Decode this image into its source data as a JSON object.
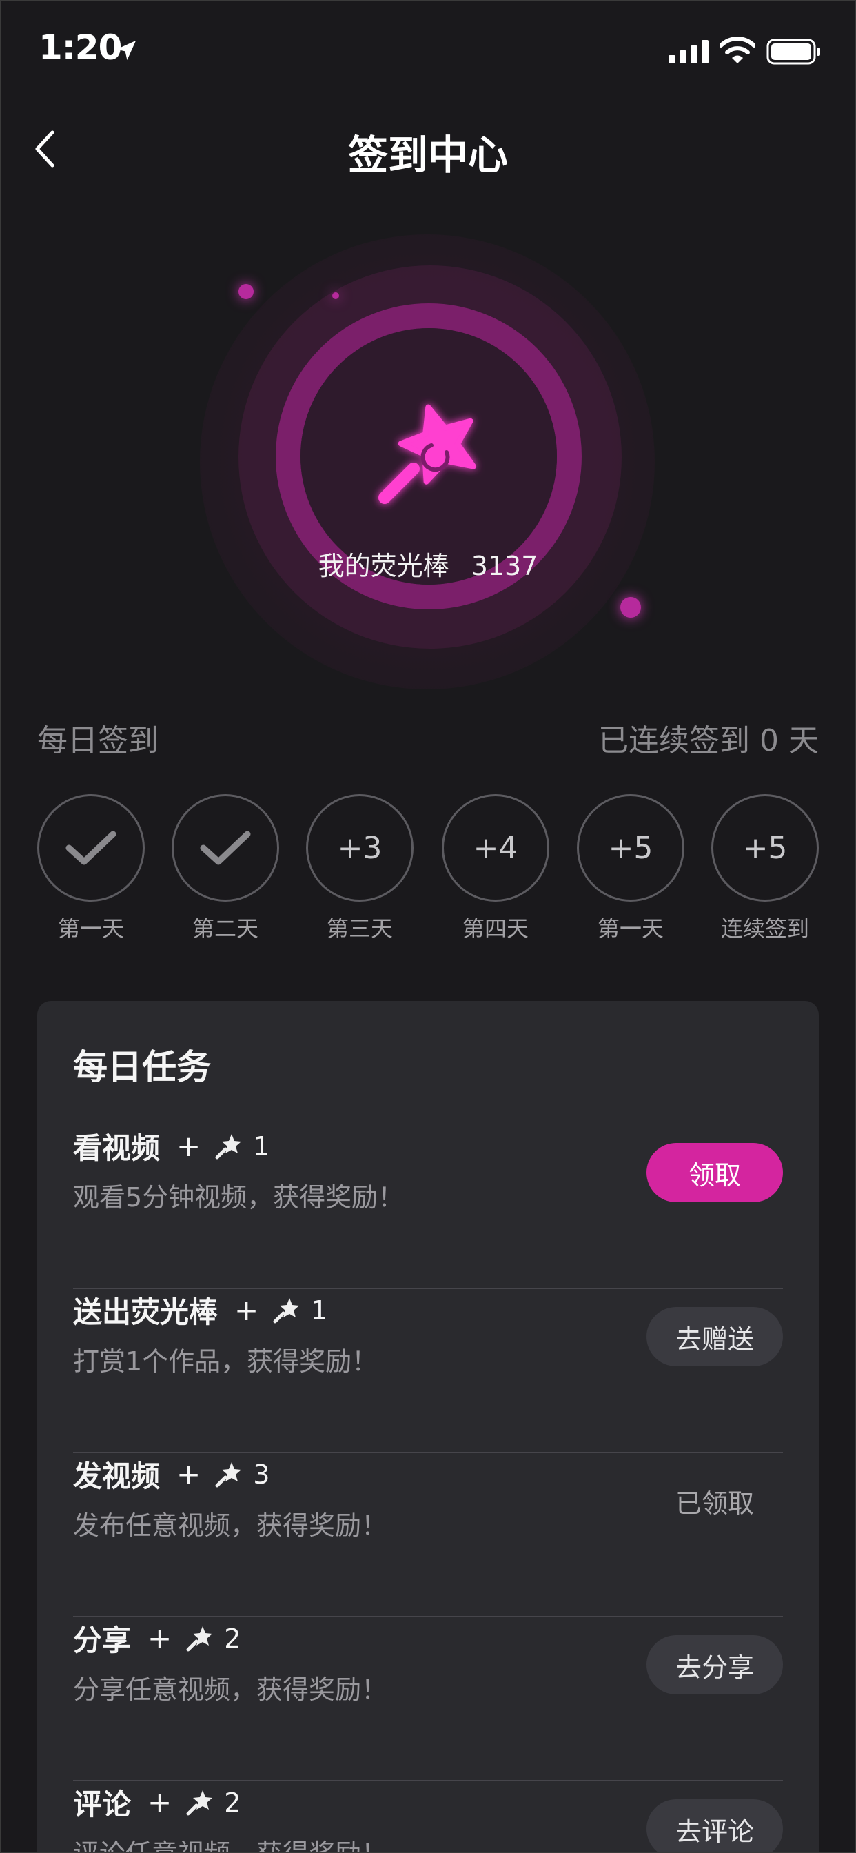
{
  "status_bar": {
    "time": "1:20"
  },
  "nav": {
    "title": "签到中心"
  },
  "hero": {
    "label": "我的荧光棒",
    "count": "3137"
  },
  "checkin": {
    "title": "每日签到",
    "streak_text": "已连续签到 0 天",
    "days": [
      {
        "value": "",
        "checked": true,
        "label": "第一天"
      },
      {
        "value": "",
        "checked": true,
        "label": "第二天"
      },
      {
        "value": "+3",
        "checked": false,
        "label": "第三天"
      },
      {
        "value": "+4",
        "checked": false,
        "label": "第四天"
      },
      {
        "value": "+5",
        "checked": false,
        "label": "第一天"
      },
      {
        "value": "+5",
        "checked": false,
        "label": "连续签到"
      }
    ]
  },
  "tasks": {
    "title": "每日任务",
    "items": [
      {
        "title": "看视频",
        "plus": "+",
        "reward": "1",
        "desc": "观看5分钟视频，获得奖励！",
        "button": "领取"
      },
      {
        "title": "送出荧光棒",
        "plus": "+",
        "reward": "1",
        "desc": "打赏1个作品，获得奖励！",
        "button": "去赠送"
      },
      {
        "title": "发视频",
        "plus": "+",
        "reward": "3",
        "desc": "发布任意视频，获得奖励！",
        "button": "已领取"
      },
      {
        "title": "分享",
        "plus": "+",
        "reward": "2",
        "desc": "分享任意视频，获得奖励！",
        "button": "去分享"
      },
      {
        "title": "评论",
        "plus": "+",
        "reward": "2",
        "desc": "评论任意视频，获得奖励！",
        "button": "去评论"
      }
    ]
  },
  "colors": {
    "accent": "#d4259f",
    "background": "#1a191c",
    "card": "#2a2a2e"
  }
}
